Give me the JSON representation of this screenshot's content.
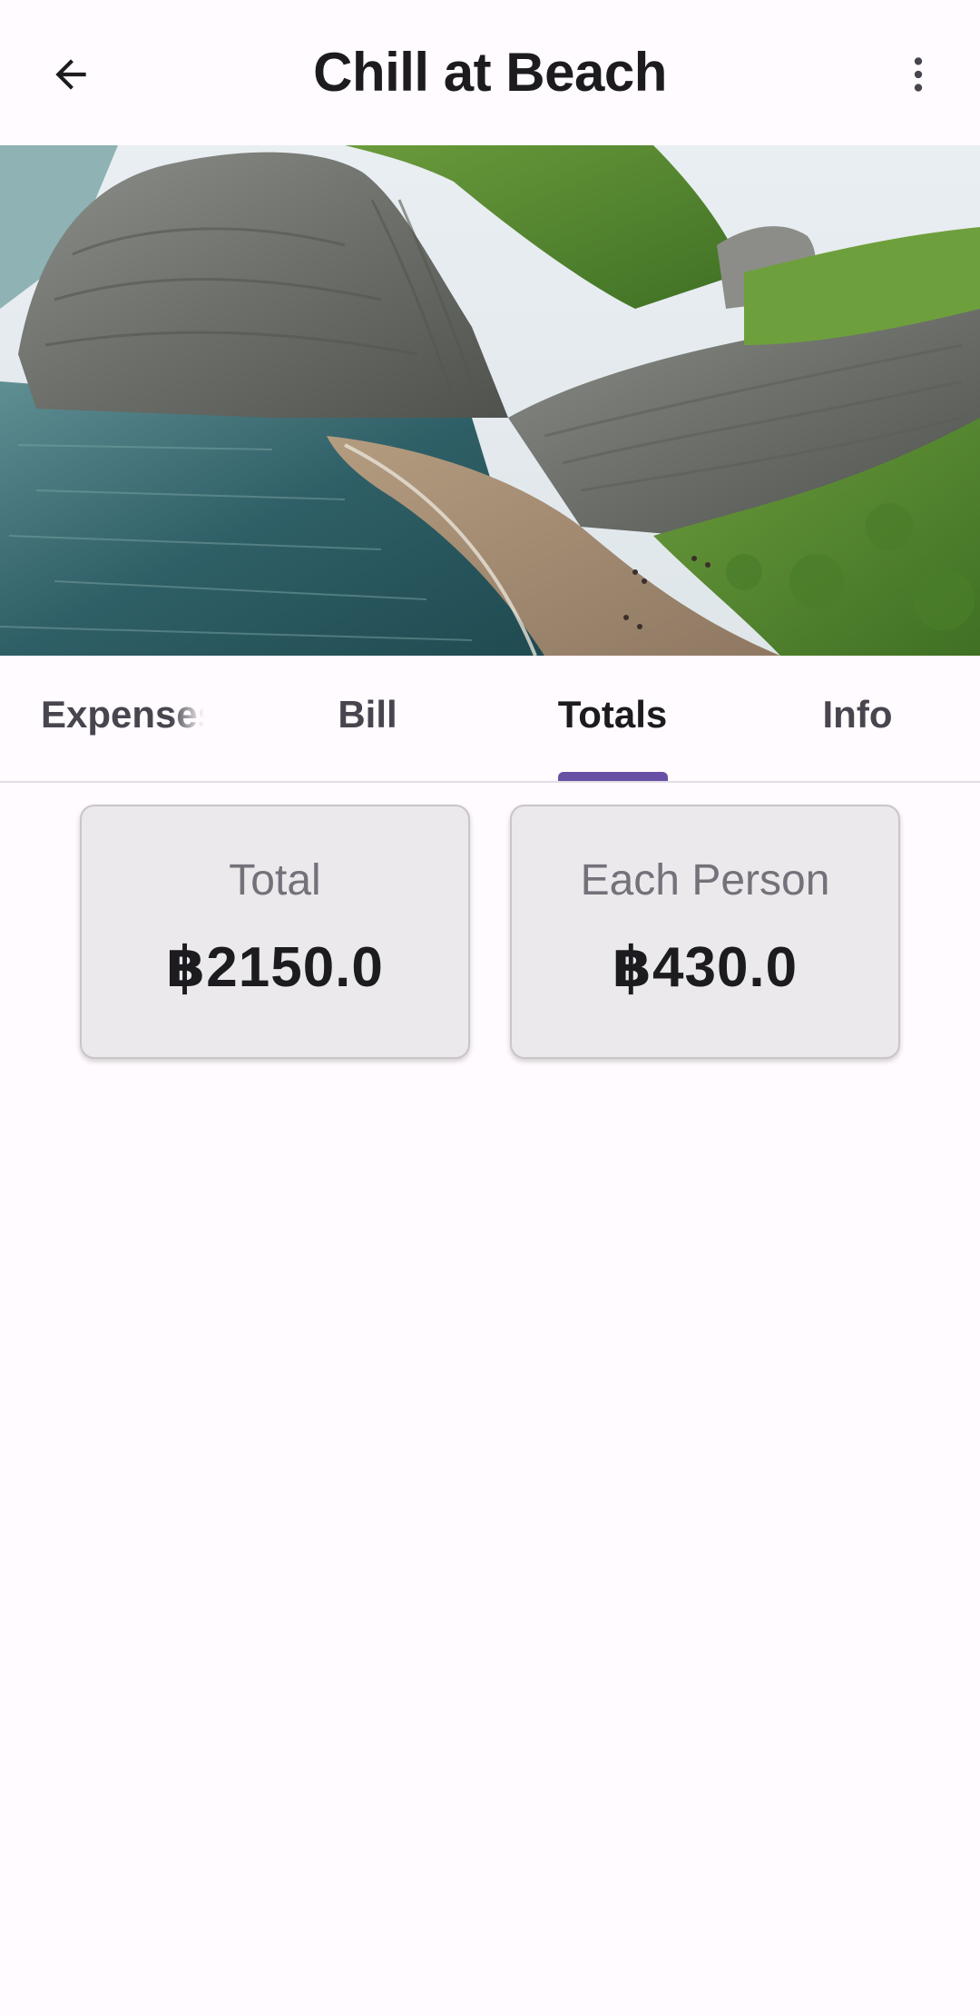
{
  "app_bar": {
    "title": "Chill at Beach",
    "back_icon": "arrow-back-icon",
    "more_icon": "more-vert-icon"
  },
  "hero_image": {
    "subject": "coastal-cliff-beach-photo"
  },
  "tabs": [
    {
      "label": "Expenses",
      "active": false
    },
    {
      "label": "Bill",
      "active": false
    },
    {
      "label": "Totals",
      "active": true
    },
    {
      "label": "Info",
      "active": false
    }
  ],
  "summary": {
    "total": {
      "label": "Total",
      "value": "฿2150.0"
    },
    "each_person": {
      "label": "Each Person",
      "value": "฿430.0"
    }
  },
  "colors": {
    "background": "#fffbfe",
    "accent": "#6750a4",
    "card_background": "#ebe9eb"
  }
}
